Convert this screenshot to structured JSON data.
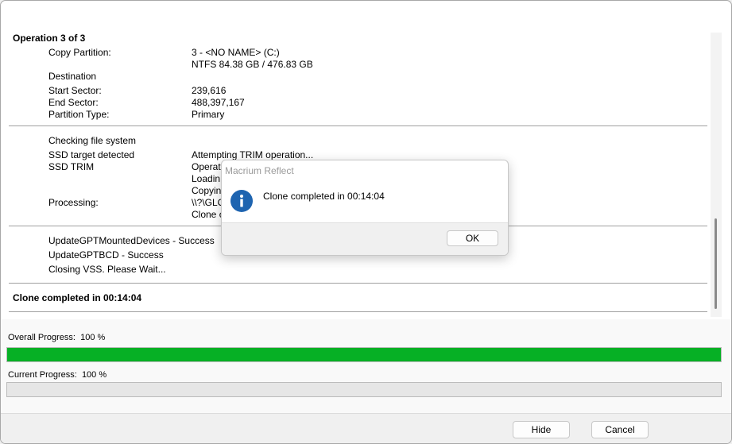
{
  "log": {
    "op_title": "Operation 3 of 3",
    "copy_partition_label": "Copy Partition:",
    "copy_partition_value": "3 - <NO NAME> (C:)",
    "copy_partition_fs": "NTFS 84.38 GB / 476.83 GB",
    "destination_label": "Destination",
    "start_sector_label": "Start Sector:",
    "start_sector_value": "239,616",
    "end_sector_label": "End Sector:",
    "end_sector_value": "488,397,167",
    "partition_type_label": "Partition Type:",
    "partition_type_value": "Primary",
    "checking_fs": "Checking file system",
    "ssd_detected_label": "SSD target detected",
    "ssd_detected_value": "Attempting TRIM operation...",
    "ssd_trim_label": "SSD TRIM",
    "ssd_trim_line1": "Operati",
    "ssd_trim_line2": "Loadin",
    "ssd_trim_line3": "Copyin",
    "processing_label": "Processing:",
    "processing_line1": "\\\\?\\GLO",
    "processing_line2": "Clone c",
    "update_gpt_devices": "UpdateGPTMountedDevices - Success",
    "update_gpt_bcd": "UpdateGPTBCD - Success",
    "closing_vss": "Closing VSS. Please Wait...",
    "clone_completed": "Clone completed in 00:14:04"
  },
  "progress": {
    "overall_label": "Overall Progress:",
    "overall_value_text": "100 %",
    "overall_value": 100,
    "current_label": "Current Progress:",
    "current_value_text": "100 %",
    "current_value": 0,
    "bar_color": "#06b025"
  },
  "footer": {
    "hide_label": "Hide",
    "cancel_label": "Cancel"
  },
  "dialog": {
    "title": "Macrium Reflect",
    "message": "Clone completed in 00:14:04",
    "ok_label": "OK",
    "icon": "info-icon",
    "icon_color": "#1e64b0"
  }
}
